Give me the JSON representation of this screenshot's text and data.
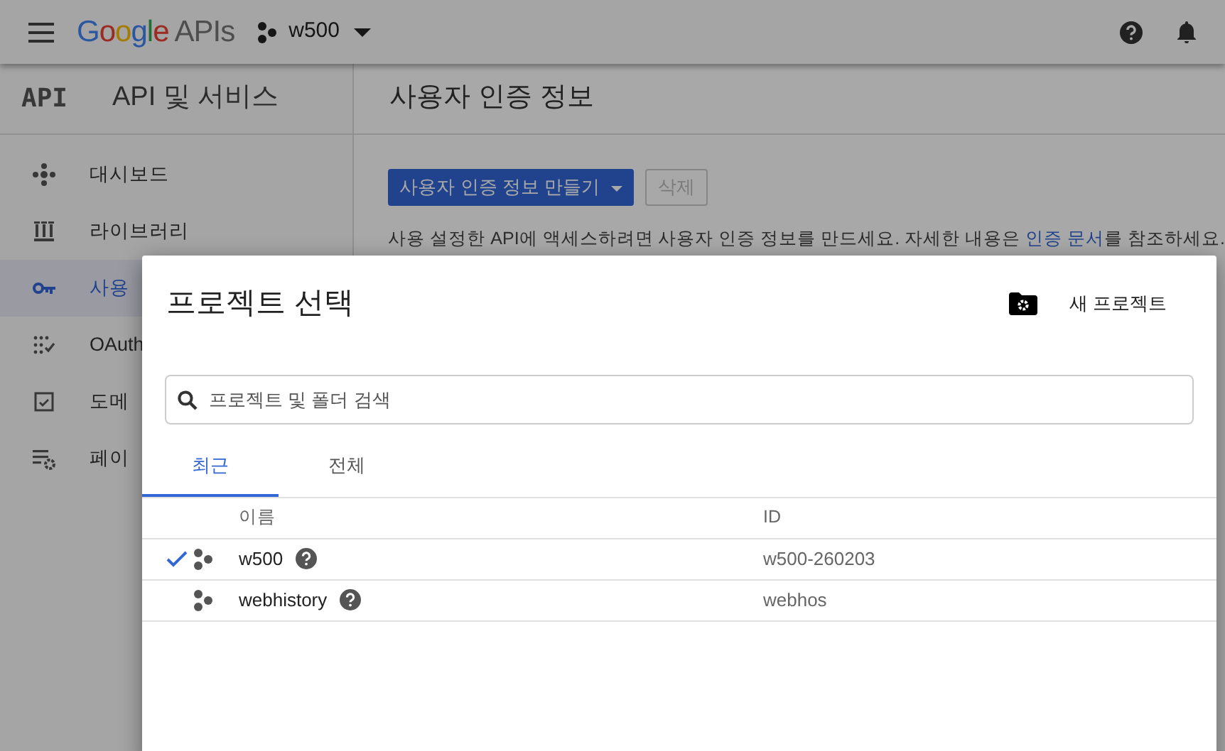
{
  "header": {
    "logo": {
      "brand": "Google",
      "product": "APIs"
    },
    "project": "w500"
  },
  "sidebar": {
    "badge": "API",
    "title": "API 및 서비스",
    "items": [
      {
        "label": "대시보드",
        "selected": false,
        "kind": "dashboard"
      },
      {
        "label": "라이브러리",
        "selected": false,
        "kind": "library"
      },
      {
        "label": "사용",
        "selected": true,
        "kind": "key"
      },
      {
        "label": "OAuth",
        "selected": false,
        "kind": "oauth"
      },
      {
        "label": "도메",
        "selected": false,
        "kind": "domain"
      },
      {
        "label": "페이",
        "selected": false,
        "kind": "page"
      }
    ]
  },
  "main": {
    "title": "사용자 인증 정보",
    "buttons": [
      {
        "label": "사용자 인증 정보 만들기",
        "kind": "dropdown",
        "disabled": false
      },
      {
        "label": "삭제",
        "kind": "plain",
        "disabled": true
      }
    ],
    "description": {
      "before": "사용 설정한 API에 액세스하려면 사용자 인증 정보를 만드세요. 자세한 내용은 ",
      "link": "인증 문서",
      "after": "를 참조하세요."
    }
  },
  "dialog": {
    "title": "프로젝트 선택",
    "new_project": "새 프로젝트",
    "search": {
      "placeholder": "프로젝트 및 폴더 검색"
    },
    "tabs": [
      {
        "label": "최근",
        "selected": true
      },
      {
        "label": "전체",
        "selected": false
      }
    ],
    "table": {
      "columns": [
        "이름",
        "ID"
      ],
      "rows": [
        {
          "name": "w500",
          "id": "w500-260203",
          "selected": true
        },
        {
          "name": "webhistory",
          "id": "webhos",
          "selected": false
        }
      ]
    }
  }
}
